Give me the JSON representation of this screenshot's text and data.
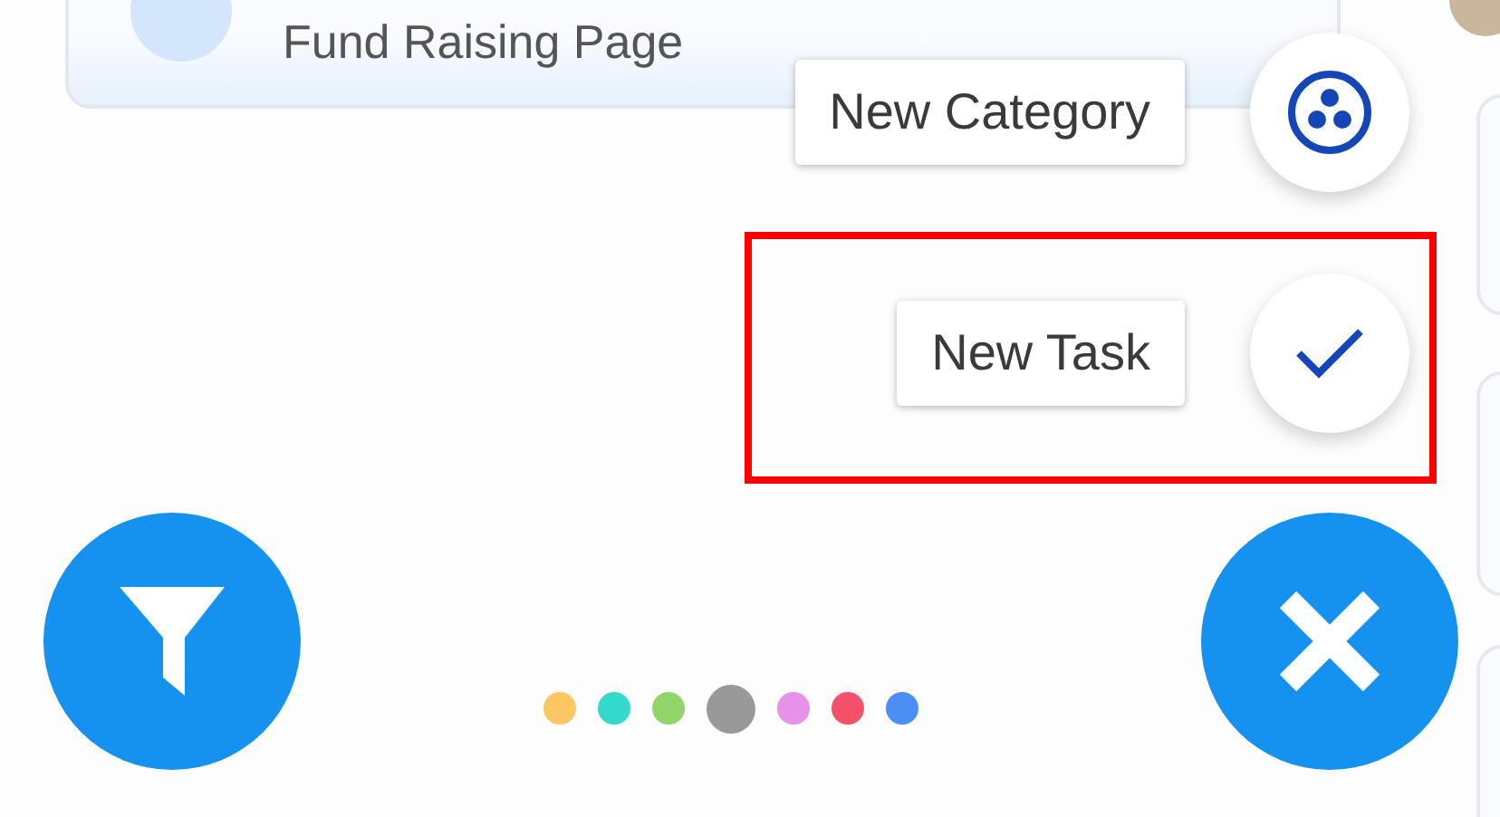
{
  "task_card": {
    "title": "Fund Raising Page"
  },
  "speed_dial": {
    "actions": [
      {
        "kind": "category",
        "label": "New Category",
        "highlighted": false
      },
      {
        "kind": "task",
        "label": "New Task",
        "highlighted": true
      }
    ]
  },
  "page_dots": [
    {
      "color": "#fcc662",
      "selected": false
    },
    {
      "color": "#33d9cb",
      "selected": false
    },
    {
      "color": "#90d46a",
      "selected": false
    },
    {
      "color": "#999999",
      "selected": true
    },
    {
      "color": "#e891e8",
      "selected": false
    },
    {
      "color": "#f5506a",
      "selected": false
    },
    {
      "color": "#4b8ff6",
      "selected": false
    }
  ]
}
